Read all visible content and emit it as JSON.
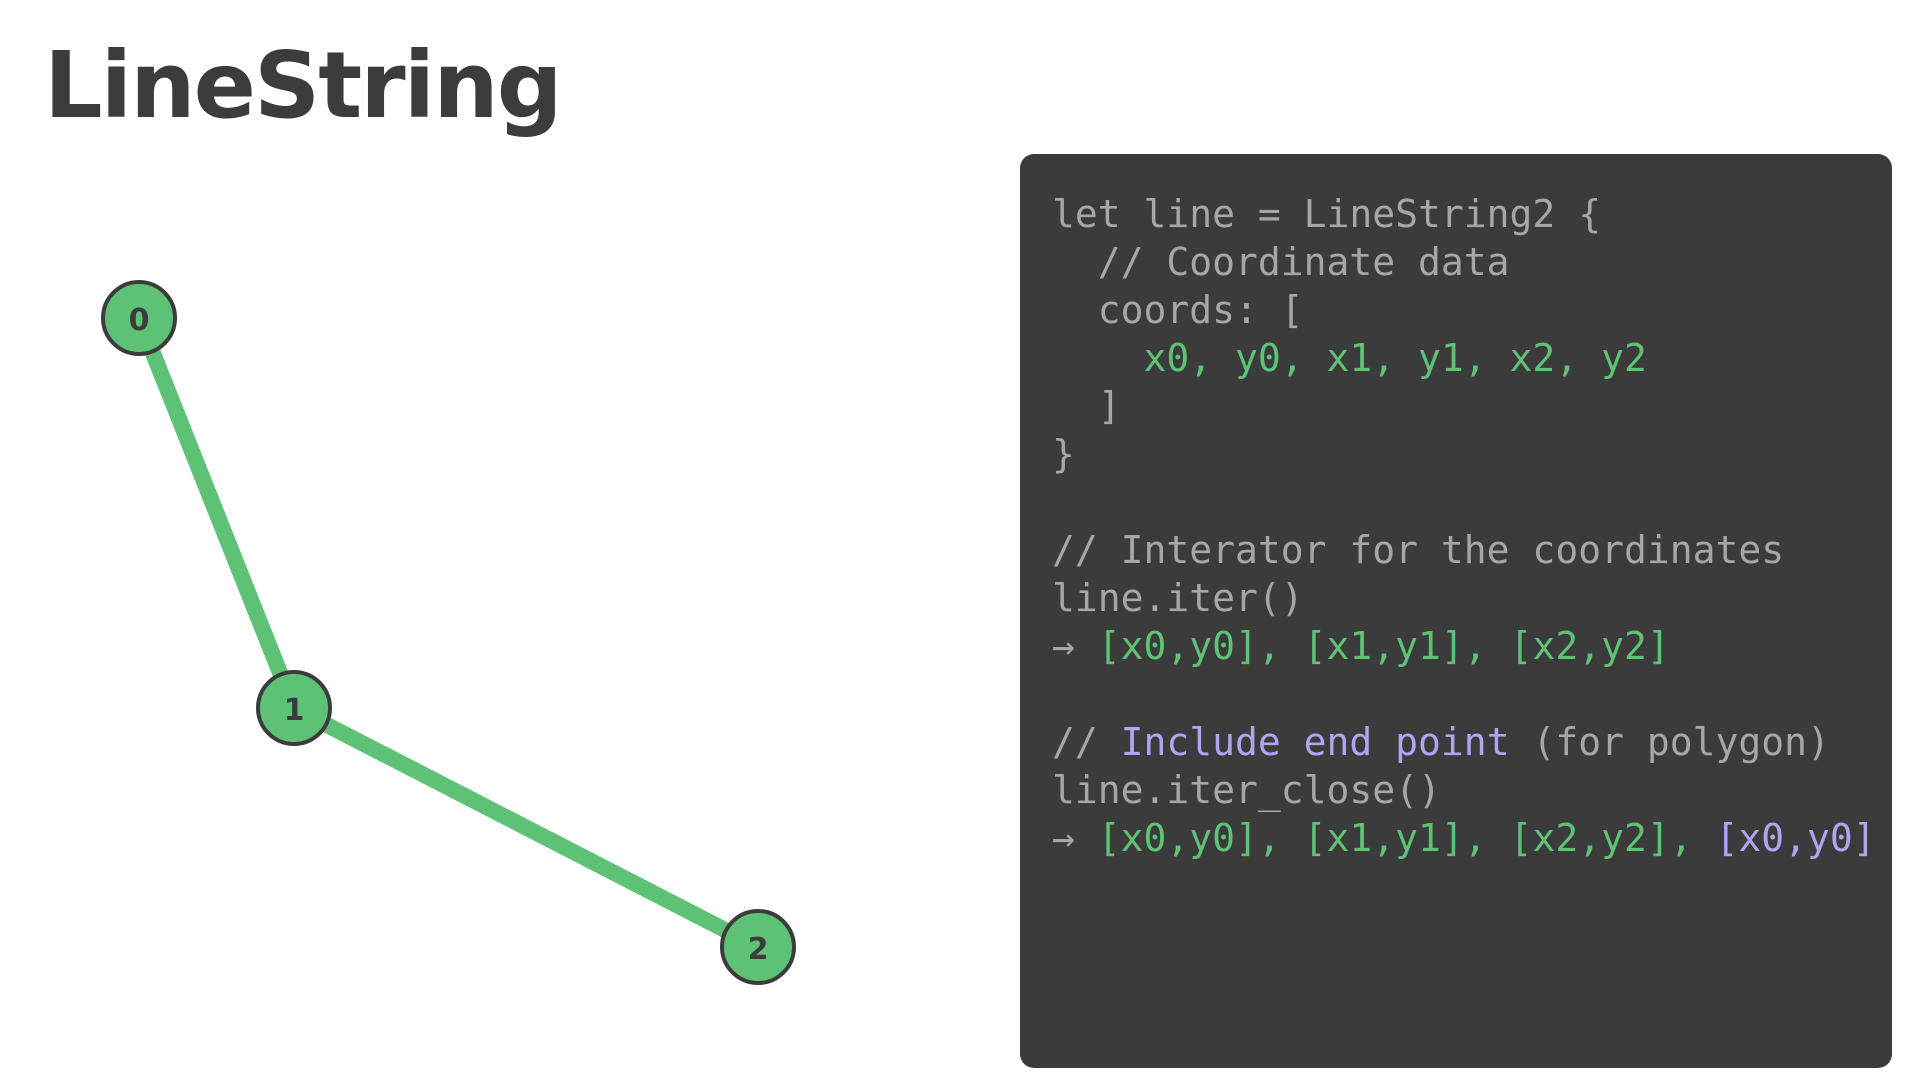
{
  "title": "LineString",
  "colors": {
    "line": "#5ec276",
    "node_fill": "#5ec276",
    "node_stroke": "#3c3c3c",
    "panel_bg": "#3b3b3b",
    "code_text": "#a6a6a6",
    "code_green": "#5ec276",
    "code_purple": "#b3a2f0"
  },
  "diagram": {
    "nodes": [
      {
        "label": "0"
      },
      {
        "label": "1"
      },
      {
        "label": "2"
      }
    ]
  },
  "code": {
    "l1": "let line = LineString2 {",
    "l2": "  // Coordinate data",
    "l3": "  coords: [",
    "l4": "    x0, y0, x1, y1, x2, y2",
    "l5": "  ]",
    "l6": "}",
    "l8": "// Interator for the coordinates",
    "l9": "line.iter()",
    "l10_arrow": "→ ",
    "l10": "[x0,y0], [x1,y1], [x2,y2]",
    "l12_a": "// ",
    "l12_b": "Include end point",
    "l12_c": " (for polygon)",
    "l13": "line.iter_close()",
    "l14_arrow": "→ ",
    "l14_a": "[x0,y0], [x1,y1], [x2,y2], ",
    "l14_b": "[x0,y0]"
  }
}
